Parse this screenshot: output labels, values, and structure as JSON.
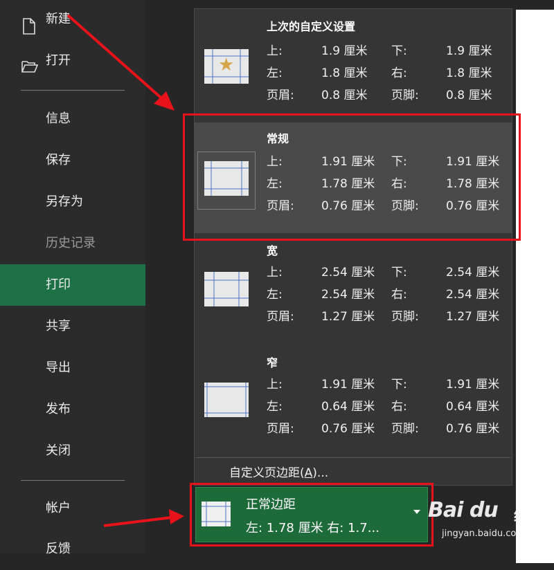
{
  "nav": {
    "items": [
      {
        "label": "新建",
        "icon": "new-document-icon"
      },
      {
        "label": "打开",
        "icon": "open-folder-icon"
      },
      {
        "label": "信息"
      },
      {
        "label": "保存"
      },
      {
        "label": "另存为"
      },
      {
        "label": "历史记录",
        "disabled": true
      },
      {
        "label": "打印",
        "active": true
      },
      {
        "label": "共享"
      },
      {
        "label": "导出"
      },
      {
        "label": "发布"
      },
      {
        "label": "关闭"
      },
      {
        "label": "帐户"
      },
      {
        "label": "反馈"
      }
    ]
  },
  "gallery": {
    "presets": [
      {
        "name": "上次的自定义设置",
        "thumb_icon": "star-icon",
        "top_label": "上:",
        "top": "1.9 厘米",
        "bottom_label": "下:",
        "bottom": "1.9 厘米",
        "left_label": "左:",
        "left": "1.8 厘米",
        "right_label": "右:",
        "right": "1.8 厘米",
        "header_label": "页眉:",
        "header": "0.8 厘米",
        "footer_label": "页脚:",
        "footer": "0.8 厘米"
      },
      {
        "name": "常规",
        "selected": true,
        "top_label": "上:",
        "top": "1.91 厘米",
        "bottom_label": "下:",
        "bottom": "1.91 厘米",
        "left_label": "左:",
        "left": "1.78 厘米",
        "right_label": "右:",
        "right": "1.78 厘米",
        "header_label": "页眉:",
        "header": "0.76 厘米",
        "footer_label": "页脚:",
        "footer": "0.76 厘米"
      },
      {
        "name": "宽",
        "top_label": "上:",
        "top": "2.54 厘米",
        "bottom_label": "下:",
        "bottom": "2.54 厘米",
        "left_label": "左:",
        "left": "2.54 厘米",
        "right_label": "右:",
        "right": "2.54 厘米",
        "header_label": "页眉:",
        "header": "1.27 厘米",
        "footer_label": "页脚:",
        "footer": "1.27 厘米"
      },
      {
        "name": "窄",
        "top_label": "上:",
        "top": "1.91 厘米",
        "bottom_label": "下:",
        "bottom": "1.91 厘米",
        "left_label": "左:",
        "left": "0.64 厘米",
        "right_label": "右:",
        "right": "0.64 厘米",
        "header_label": "页眉:",
        "header": "0.76 厘米",
        "footer_label": "页脚:",
        "footer": "0.76 厘米"
      }
    ],
    "custom_label": "自定义页边距(",
    "custom_key": "A",
    "custom_suffix": ")..."
  },
  "margin_setting": {
    "title": "正常边距",
    "subtitle": "左:  1.78 厘米    右:  1.7..."
  },
  "watermark": {
    "brand": "Bai du",
    "suffix": "经验",
    "url": "jingyan.baidu.com"
  },
  "colors": {
    "active_nav": "#1e7145",
    "highlight": "#e8121a",
    "setting_button": "#1e6b3a",
    "margin_guides": "#4a72c4"
  }
}
